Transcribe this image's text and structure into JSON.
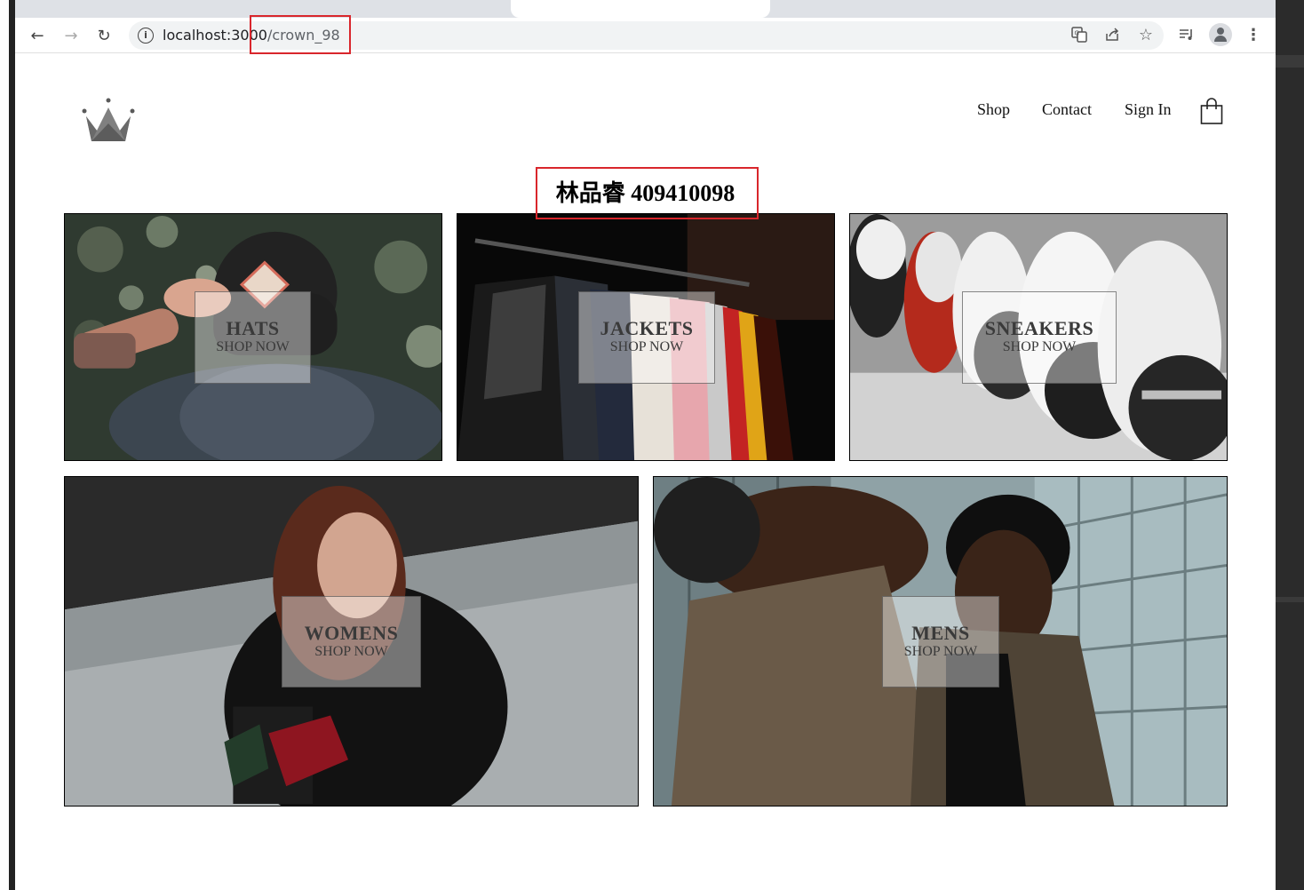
{
  "browser": {
    "url_host": "localhost:3000",
    "url_path": "/crown_98"
  },
  "header": {
    "nav": [
      "Shop",
      "Contact",
      "Sign In"
    ]
  },
  "heading": "林品睿 409410098",
  "categories": [
    {
      "title": "HATS",
      "subtitle": "SHOP NOW"
    },
    {
      "title": "JACKETS",
      "subtitle": "SHOP NOW"
    },
    {
      "title": "SNEAKERS",
      "subtitle": "SHOP NOW"
    },
    {
      "title": "WOMENS",
      "subtitle": "SHOP NOW"
    },
    {
      "title": "MENS",
      "subtitle": "SHOP NOW"
    }
  ],
  "icons": {
    "back": "arrow-left-icon",
    "forward": "arrow-right-icon",
    "reload": "reload-icon",
    "info": "info-icon",
    "translate": "translate-icon",
    "share": "share-icon",
    "bookmark": "star-icon",
    "reading_list": "reading-list-icon",
    "profile": "profile-icon",
    "menu": "kebab-menu-icon",
    "logo": "crown-logo-icon",
    "cart": "shopping-bag-icon"
  },
  "colors": {
    "highlight_box": "#d9262c",
    "text": "#111111"
  }
}
